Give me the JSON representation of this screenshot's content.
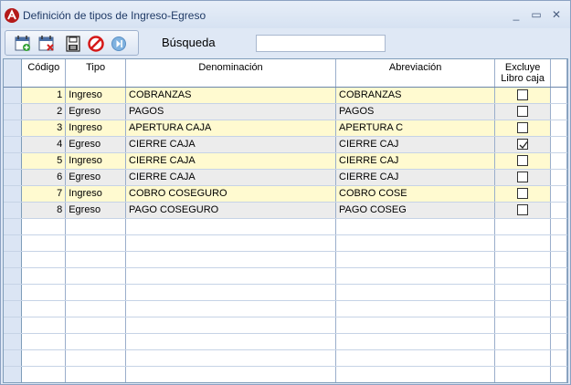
{
  "window": {
    "title": "Definición de tipos de Ingreso-Egreso",
    "minimize_glyph": "_",
    "maximize_glyph": "▭",
    "close_glyph": "✕"
  },
  "toolbar": {
    "buttons": [
      {
        "name": "new-record-icon",
        "icon": "calendar-add"
      },
      {
        "name": "delete-record-icon",
        "icon": "calendar-delete"
      },
      {
        "name": "save-icon",
        "icon": "floppy-disk"
      },
      {
        "name": "cancel-icon",
        "icon": "prohibited"
      },
      {
        "name": "exit-icon",
        "icon": "skip-next"
      }
    ]
  },
  "search": {
    "label": "Búsqueda",
    "value": "",
    "placeholder": ""
  },
  "grid": {
    "columns": [
      "Código",
      "Tipo",
      "Denominación",
      "Abreviación",
      "Excluye\nLibro caja"
    ],
    "rows": [
      {
        "codigo": "1",
        "tipo": "Ingreso",
        "denominacion": "COBRANZAS",
        "abreviacion": "COBRANZAS",
        "excluye": false
      },
      {
        "codigo": "2",
        "tipo": "Egreso",
        "denominacion": "PAGOS",
        "abreviacion": "PAGOS",
        "excluye": false
      },
      {
        "codigo": "3",
        "tipo": "Ingreso",
        "denominacion": "APERTURA CAJA",
        "abreviacion": "APERTURA C",
        "excluye": false
      },
      {
        "codigo": "4",
        "tipo": "Egreso",
        "denominacion": "CIERRE CAJA",
        "abreviacion": "CIERRE CAJ",
        "excluye": true
      },
      {
        "codigo": "5",
        "tipo": "Ingreso",
        "denominacion": "CIERRE CAJA",
        "abreviacion": "CIERRE CAJ",
        "excluye": false
      },
      {
        "codigo": "6",
        "tipo": "Egreso",
        "denominacion": "CIERRE CAJA",
        "abreviacion": "CIERRE CAJ",
        "excluye": false
      },
      {
        "codigo": "7",
        "tipo": "Ingreso",
        "denominacion": "COBRO COSEGURO",
        "abreviacion": "COBRO COSE",
        "excluye": false
      },
      {
        "codigo": "8",
        "tipo": "Egreso",
        "denominacion": "PAGO COSEGURO",
        "abreviacion": "PAGO COSEG",
        "excluye": false
      }
    ],
    "colors": {
      "odd_row": "#fffad0",
      "even_row": "#ececec",
      "row_header": "#dbe5f4"
    }
  }
}
